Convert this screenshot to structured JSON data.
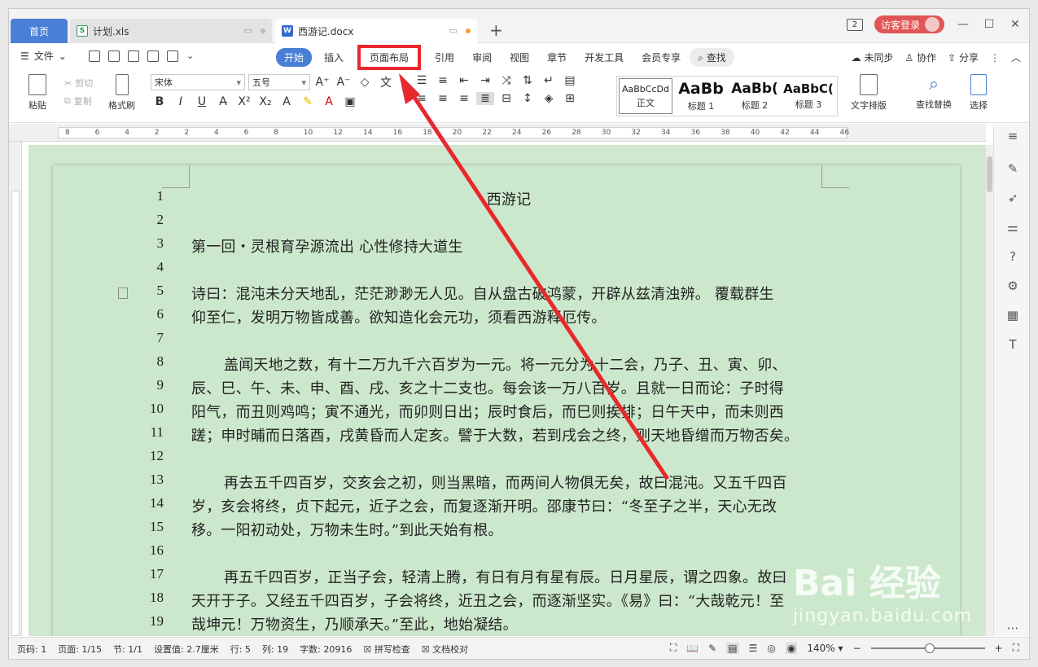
{
  "tabs": {
    "home": "首页",
    "xls": "计划.xls",
    "doc": "西游记.docx"
  },
  "titlebar": {
    "badge": "2",
    "login": "访客登录"
  },
  "menu": {
    "file": "文件",
    "items": [
      "开始",
      "插入",
      "页面布局",
      "引用",
      "审阅",
      "视图",
      "章节",
      "开发工具",
      "会员专享",
      "查找"
    ],
    "right": [
      "未同步",
      "协作",
      "分享"
    ]
  },
  "ribbon": {
    "paste": "粘贴",
    "cut": "剪切",
    "copy": "复制",
    "format_painter": "格式刷",
    "font": "宋体",
    "size": "五号",
    "styles": [
      {
        "preview": "AaBbCcDd",
        "label": "正文"
      },
      {
        "preview": "AaBb",
        "label": "标题 1"
      },
      {
        "preview": "AaBb(",
        "label": "标题 2"
      },
      {
        "preview": "AaBbC(",
        "label": "标题 3"
      }
    ],
    "text_layout": "文字排版",
    "find_replace": "查找替换",
    "select": "选择"
  },
  "ruler": {
    "marks": [
      "8",
      "6",
      "4",
      "2",
      "2",
      "4",
      "6",
      "8",
      "10",
      "12",
      "14",
      "16",
      "18",
      "20",
      "22",
      "24",
      "26",
      "28",
      "30",
      "32",
      "34",
      "36",
      "38",
      "40",
      "42",
      "44",
      "46"
    ]
  },
  "document": {
    "lines": [
      {
        "n": "1",
        "text": "西游记",
        "style": "center"
      },
      {
        "n": "2",
        "text": "",
        "style": ""
      },
      {
        "n": "3",
        "text": "第一回・灵根育孕源流出 心性修持大道生",
        "style": ""
      },
      {
        "n": "4",
        "text": "",
        "style": ""
      },
      {
        "n": "5",
        "text": "诗曰：混沌未分天地乱，茫茫渺渺无人见。自从盘古破鸿蒙，开辟从兹清浊辨。 覆载群生",
        "style": ""
      },
      {
        "n": "6",
        "text": "仰至仁，发明万物皆成善。欲知造化会元功，须看西游释厄传。",
        "style": ""
      },
      {
        "n": "7",
        "text": "",
        "style": ""
      },
      {
        "n": "8",
        "text": "盖闻天地之数，有十二万九千六百岁为一元。将一元分为十二会，乃子、丑、寅、卯、",
        "style": "indent"
      },
      {
        "n": "9",
        "text": "辰、巳、午、未、申、酉、戌、亥之十二支也。每会该一万八百岁。且就一日而论：子时得",
        "style": ""
      },
      {
        "n": "10",
        "text": "阳气，而丑则鸡鸣；寅不通光，而卯则日出；辰时食后，而巳则挨排；日午天中，而未则西",
        "style": ""
      },
      {
        "n": "11",
        "text": "蹉；申时晡而日落酉，戌黄昏而人定亥。譬于大数，若到戌会之终，则天地昏缯而万物否矣。",
        "style": ""
      },
      {
        "n": "12",
        "text": "",
        "style": ""
      },
      {
        "n": "13",
        "text": "再去五千四百岁，交亥会之初，则当黑暗，而两间人物俱无矣，故曰混沌。又五千四百",
        "style": "indent"
      },
      {
        "n": "14",
        "text": "岁，亥会将终，贞下起元，近子之会，而复逐渐开明。邵康节曰：“冬至子之半，天心无改",
        "style": ""
      },
      {
        "n": "15",
        "text": "移。一阳初动处，万物未生时。”到此天始有根。",
        "style": ""
      },
      {
        "n": "16",
        "text": "",
        "style": ""
      },
      {
        "n": "17",
        "text": "再五千四百岁，正当子会，轻清上腾，有日有月有星有辰。日月星辰，谓之四象。故曰",
        "style": "indent"
      },
      {
        "n": "18",
        "text": "天开于子。又经五千四百岁，子会将终，近丑之会，而逐渐坚实。《易》曰：“大哉乾元！至",
        "style": ""
      },
      {
        "n": "19",
        "text": "哉坤元！万物资生，乃顺承天。”至此，地始凝结。",
        "style": ""
      }
    ]
  },
  "status": {
    "page_code": "页码: 1",
    "pages": "页面: 1/15",
    "section": "节: 1/1",
    "setting": "设置值: 2.7厘米",
    "row": "行: 5",
    "col": "列: 19",
    "words": "字数: 20916",
    "spell": "拼写检查",
    "proof": "文档校对",
    "zoom": "140%"
  },
  "watermark": {
    "brand": "Bai 经验",
    "url": "jingyan.baidu.com"
  },
  "colors": {
    "accent": "#4a7fd6",
    "highlight_box": "#e8272e",
    "doc_bg": "#cce8cc",
    "login": "#e05656"
  }
}
